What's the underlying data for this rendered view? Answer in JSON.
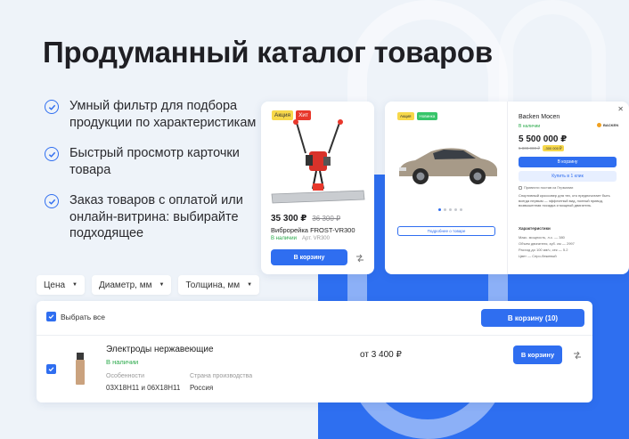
{
  "headline": "Продуманный каталог товаров",
  "features": [
    "Умный фильтр для подбора продукции по характеристикам",
    "Быстрый просмотр карточки товара",
    "Заказ товаров с оплатой или онлайн-витрина: выбирайте подходящее"
  ],
  "product_card": {
    "badge_sale": "Акция",
    "badge_hit": "Хит",
    "price": "35 300 ₽",
    "old_price": "36 300 ₽",
    "name": "Виброрейка FROST-VR300",
    "stock": "В наличии",
    "sku": "Арт. VR300",
    "cart_label": "В корзину",
    "compare_icon": "scales-icon"
  },
  "quick_view": {
    "badge_sale": "Акция",
    "badge_new": "Новинка",
    "more_label": "Подробнее о товаре",
    "brand": "Backen Mocen",
    "brand_logo": "BACKEN",
    "stock": "В наличии",
    "price": "5 500 000 ₽",
    "old_price": "5 800 000 ₽",
    "save": "-300 000 ₽",
    "cart_label": "В корзину",
    "one_click_label": "Купить в 1 клик",
    "option_label": "Привезти постав из Германии",
    "description": "Спортивный кроссовер для тех, кто предпочитает быть всегда первым — эффектный вид, полный привод, возвышенная посадка и мощный двигатель.",
    "spec_title": "Характеристики",
    "specs": [
      "Макс. мощность, л.с. — 380",
      "Объем двигателя, куб. см — 2997",
      "Расход до 100 км/ч, сек — 5.2",
      "Цвет — Серо-бежевый"
    ]
  },
  "filters": [
    {
      "label": "Цена"
    },
    {
      "label": "Диаметр, мм"
    },
    {
      "label": "Толщина, мм"
    }
  ],
  "list": {
    "select_all": "Выбрать все",
    "cart_all_label": "В корзину (10)",
    "item": {
      "name": "Электроды нержавеющие",
      "stock": "В наличии",
      "feature_label": "Особенности",
      "feature_value": "03Х18Н11 и 06Х18Н11",
      "country_label": "Страна производства",
      "country_value": "Россия",
      "price": "от 3 400 ₽",
      "cart_label": "В корзину"
    }
  },
  "colors": {
    "accent": "#2f6ef0",
    "stock_green": "#2aa94a",
    "badge_yellow": "#f7d84a",
    "badge_red": "#e8382c",
    "badge_green": "#37c56a"
  }
}
